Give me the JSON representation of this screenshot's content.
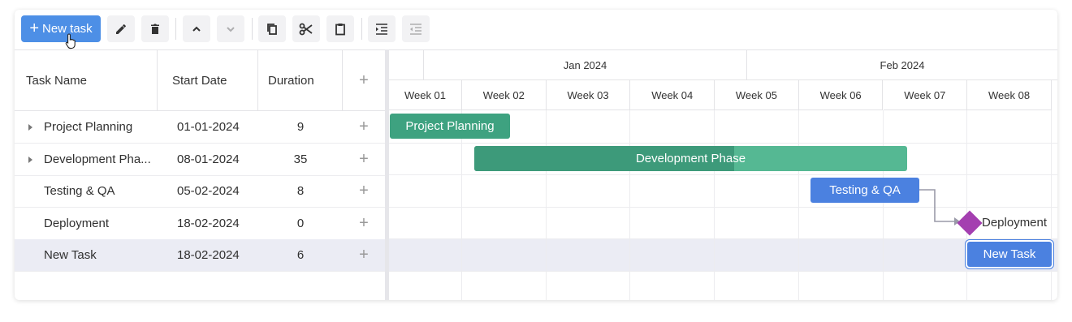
{
  "toolbar": {
    "new_task_label": "New task",
    "buttons": [
      "edit-icon",
      "delete-icon",
      "move-up-icon",
      "move-down-icon",
      "copy-icon",
      "cut-icon",
      "paste-icon",
      "indent-icon",
      "outdent-icon"
    ]
  },
  "grid": {
    "columns": {
      "name": "Task Name",
      "start": "Start Date",
      "duration": "Duration",
      "add": "+"
    },
    "rows": [
      {
        "name": "Project Planning",
        "start": "01-01-2024",
        "duration": "9",
        "expandable": true,
        "selected": false
      },
      {
        "name": "Development Pha...",
        "start": "08-01-2024",
        "duration": "35",
        "expandable": true,
        "selected": false
      },
      {
        "name": "Testing & QA",
        "start": "05-02-2024",
        "duration": "8",
        "expandable": false,
        "selected": false
      },
      {
        "name": "Deployment",
        "start": "18-02-2024",
        "duration": "0",
        "expandable": false,
        "selected": false
      },
      {
        "name": "New Task",
        "start": "18-02-2024",
        "duration": "6",
        "expandable": false,
        "selected": true
      }
    ],
    "row_add_label": "+"
  },
  "timeline": {
    "months": [
      "Jan 2024",
      "Feb 2024"
    ],
    "weeks": [
      "Week 01",
      "Week 02",
      "Week 03",
      "Week 04",
      "Week 05",
      "Week 06",
      "Week 07",
      "Week 08"
    ],
    "bars": [
      {
        "label": "Project Planning",
        "type": "task",
        "color": "#3ea280",
        "progress_color": "#3ea280",
        "progress": 1.0
      },
      {
        "label": "Development Phase",
        "type": "task",
        "color": "#55b893",
        "progress_color": "#3d9a7a",
        "progress": 0.6
      },
      {
        "label": "Testing & QA",
        "type": "task",
        "color": "#4b81e0",
        "progress_color": "#4b81e0",
        "progress": 0
      },
      {
        "label": "Deployment",
        "type": "milestone",
        "color": "#a43fb0"
      },
      {
        "label": "New Task",
        "type": "task",
        "color": "#4b81e0",
        "progress_color": "#4b81e0",
        "progress": 0,
        "selected": true
      }
    ]
  },
  "colors": {
    "accent": "#4d8fe6",
    "link": "#9a9aa8",
    "selected_row": "#ebecf4"
  }
}
